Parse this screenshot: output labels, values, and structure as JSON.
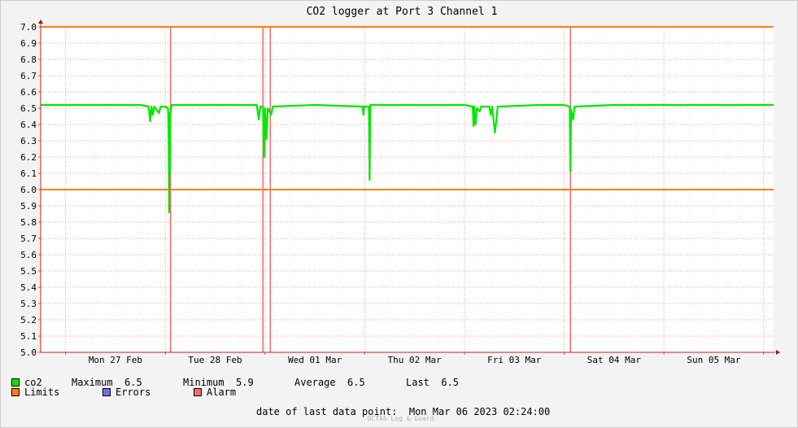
{
  "chart_data": {
    "type": "line",
    "title": "CO2 logger at Port 3 Channel 1",
    "xlabel": "",
    "ylabel": "",
    "ylim": [
      5.0,
      7.0
    ],
    "y_ticks": [
      "5.0",
      "5.1",
      "5.2",
      "5.3",
      "5.4",
      "5.5",
      "5.6",
      "5.7",
      "5.8",
      "5.9",
      "6.0",
      "6.1",
      "6.2",
      "6.3",
      "6.4",
      "6.5",
      "6.6",
      "6.7",
      "6.8",
      "6.9",
      "7.0"
    ],
    "x_range": [
      "2023-02-26 18:00",
      "2023-03-06 02:24"
    ],
    "x_ticks": [
      {
        "label": "Mon 27 Feb",
        "t": "2023-02-27 00:00"
      },
      {
        "label": "Tue 28 Feb",
        "t": "2023-02-28 00:00"
      },
      {
        "label": "Wed 01 Mar",
        "t": "2023-03-01 00:00"
      },
      {
        "label": "Thu 02 Mar",
        "t": "2023-03-02 00:00"
      },
      {
        "label": "Fri 03 Mar",
        "t": "2023-03-03 00:00"
      },
      {
        "label": "Sat 04 Mar",
        "t": "2023-03-04 00:00"
      },
      {
        "label": "Sun 05 Mar",
        "t": "2023-03-05 00:00"
      }
    ],
    "grid": true,
    "limits": [
      {
        "name": "Limits",
        "values": [
          6.0,
          7.0
        ],
        "color": "#ff7f00"
      }
    ],
    "alarms": {
      "name": "Alarm",
      "color": "#f06060",
      "times": [
        "2023-02-28 01:15",
        "2023-02-28 23:30",
        "2023-03-01 01:15",
        "2023-03-04 01:30"
      ]
    },
    "series": [
      {
        "name": "co2",
        "color": "#00e800",
        "points": [
          [
            "2023-02-26 18:00",
            6.52
          ],
          [
            "2023-02-27 06:00",
            6.52
          ],
          [
            "2023-02-27 18:00",
            6.52
          ],
          [
            "2023-02-27 20:00",
            6.51
          ],
          [
            "2023-02-27 20:20",
            6.42
          ],
          [
            "2023-02-27 20:40",
            6.51
          ],
          [
            "2023-02-27 21:00",
            6.46
          ],
          [
            "2023-02-27 21:20",
            6.51
          ],
          [
            "2023-02-27 22:30",
            6.47
          ],
          [
            "2023-02-27 22:50",
            6.51
          ],
          [
            "2023-02-28 00:00",
            6.51
          ],
          [
            "2023-02-28 00:40",
            6.5
          ],
          [
            "2023-02-28 00:50",
            6.25
          ],
          [
            "2023-02-28 00:55",
            5.86
          ],
          [
            "2023-02-28 01:00",
            6.47
          ],
          [
            "2023-02-28 01:05",
            6.1
          ],
          [
            "2023-02-28 01:10",
            6.45
          ],
          [
            "2023-02-28 01:30",
            6.52
          ],
          [
            "2023-02-28 22:00",
            6.52
          ],
          [
            "2023-02-28 22:30",
            6.43
          ],
          [
            "2023-02-28 22:50",
            6.51
          ],
          [
            "2023-02-28 23:30",
            6.51
          ],
          [
            "2023-02-28 23:40",
            6.3
          ],
          [
            "2023-02-28 23:50",
            6.2
          ],
          [
            "2023-03-01 00:00",
            6.5
          ],
          [
            "2023-03-01 00:20",
            6.31
          ],
          [
            "2023-03-01 00:40",
            6.5
          ],
          [
            "2023-03-01 01:30",
            6.46
          ],
          [
            "2023-03-01 01:50",
            6.51
          ],
          [
            "2023-03-01 12:00",
            6.52
          ],
          [
            "2023-03-01 23:30",
            6.51
          ],
          [
            "2023-03-01 23:40",
            6.46
          ],
          [
            "2023-03-01 23:50",
            6.51
          ],
          [
            "2023-03-02 01:00",
            6.51
          ],
          [
            "2023-03-02 01:10",
            6.06
          ],
          [
            "2023-03-02 01:20",
            6.52
          ],
          [
            "2023-03-02 12:00",
            6.52
          ],
          [
            "2023-03-03 00:00",
            6.52
          ],
          [
            "2023-03-03 02:00",
            6.51
          ],
          [
            "2023-03-03 02:10",
            6.39
          ],
          [
            "2023-03-03 02:20",
            6.51
          ],
          [
            "2023-03-03 02:40",
            6.4
          ],
          [
            "2023-03-03 03:00",
            6.5
          ],
          [
            "2023-03-03 03:40",
            6.48
          ],
          [
            "2023-03-03 04:00",
            6.51
          ],
          [
            "2023-03-03 06:00",
            6.51
          ],
          [
            "2023-03-03 06:20",
            6.46
          ],
          [
            "2023-03-03 06:40",
            6.51
          ],
          [
            "2023-03-03 07:20",
            6.35
          ],
          [
            "2023-03-03 07:40",
            6.42
          ],
          [
            "2023-03-03 08:00",
            6.51
          ],
          [
            "2023-03-03 18:00",
            6.52
          ],
          [
            "2023-03-04 00:00",
            6.52
          ],
          [
            "2023-03-04 01:20",
            6.51
          ],
          [
            "2023-03-04 01:30",
            6.11
          ],
          [
            "2023-03-04 01:40",
            6.49
          ],
          [
            "2023-03-04 02:10",
            6.43
          ],
          [
            "2023-03-04 02:30",
            6.51
          ],
          [
            "2023-03-04 12:00",
            6.52
          ],
          [
            "2023-03-05 00:00",
            6.52
          ],
          [
            "2023-03-05 12:00",
            6.52
          ],
          [
            "2023-03-06 02:24",
            6.52
          ]
        ]
      }
    ]
  },
  "legend": {
    "co2": {
      "label": "co2",
      "color": "#00e800",
      "maximum_label": "Maximum",
      "maximum": "6.5",
      "minimum_label": "Minimum",
      "minimum": "5.9",
      "average_label": "Average",
      "average": "6.5",
      "last_label": "Last",
      "last": "6.5"
    },
    "limits": {
      "label": "Limits",
      "color": "#ff7f00"
    },
    "errors": {
      "label": "Errors",
      "color": "#7070ff"
    },
    "alarm": {
      "label": "Alarm",
      "color": "#f07070"
    }
  },
  "last_data_point": {
    "label": "date of last data point:",
    "value": "Mon Mar 06 2023 02:24:00"
  },
  "footer": "OCTAS Log & Guard"
}
